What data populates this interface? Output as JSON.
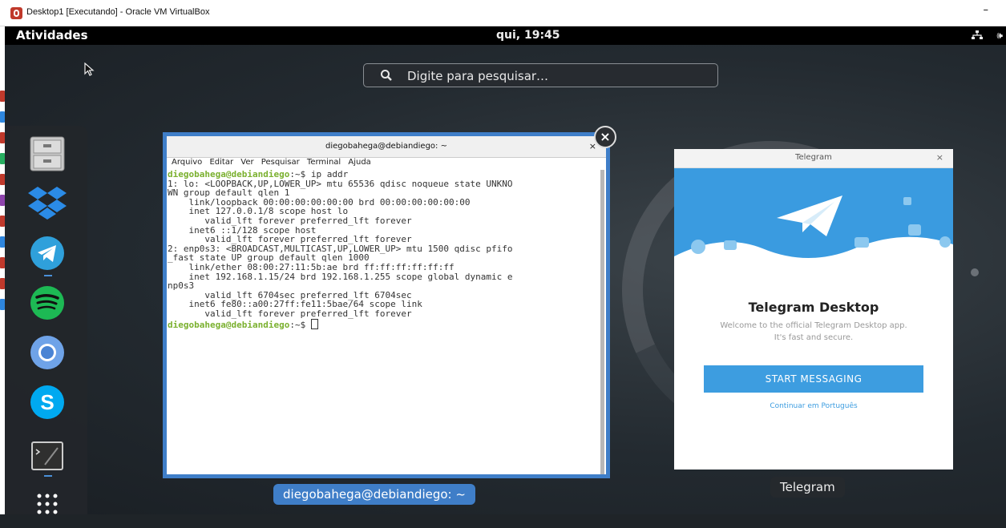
{
  "host": {
    "window_title": "Desktop1 [Executando] - Oracle VM VirtualBox",
    "minimize_symbol": "–",
    "strip_colors": [
      "#c0392b",
      "#2e86de",
      "#c0392b",
      "#27ae60",
      "#c0392b",
      "#8e44ad",
      "#c0392b",
      "#2e86de",
      "#c0392b",
      "#c0392b",
      "#2e86de"
    ]
  },
  "top_bar": {
    "activities": "Atividades",
    "clock": "qui, 19:45",
    "volume_icon": "🕪"
  },
  "search": {
    "placeholder": "Digite para pesquisar…"
  },
  "dash": {
    "apps": [
      {
        "name": "files",
        "icon": "file-cabinet-icon"
      },
      {
        "name": "dropbox",
        "icon": "dropbox-icon"
      },
      {
        "name": "telegram",
        "icon": "telegram-icon",
        "running": true
      },
      {
        "name": "spotify",
        "icon": "spotify-icon"
      },
      {
        "name": "chromium",
        "icon": "chromium-icon"
      },
      {
        "name": "skype",
        "icon": "skype-icon"
      },
      {
        "name": "terminal",
        "icon": "terminal-icon",
        "running": true
      },
      {
        "name": "show-applications",
        "icon": "app-grid-icon"
      }
    ]
  },
  "terminal": {
    "title": "diegobahega@debiandiego: ~",
    "close": "×",
    "menu": [
      "Arquivo",
      "Editar",
      "Ver",
      "Pesquisar",
      "Terminal",
      "Ajuda"
    ],
    "prompt": "diegobahega@debiandiego",
    "prompt_suffix": ":~$ ",
    "command": "ip addr",
    "output": [
      "1: lo: <LOOPBACK,UP,LOWER_UP> mtu 65536 qdisc noqueue state UNKNO",
      "WN group default qlen 1",
      "    link/loopback 00:00:00:00:00:00 brd 00:00:00:00:00:00",
      "    inet 127.0.0.1/8 scope host lo",
      "       valid_lft forever preferred_lft forever",
      "    inet6 ::1/128 scope host",
      "       valid_lft forever preferred_lft forever",
      "2: enp0s3: <BROADCAST,MULTICAST,UP,LOWER_UP> mtu 1500 qdisc pfifo",
      "_fast state UP group default qlen 1000",
      "    link/ether 08:00:27:11:5b:ae brd ff:ff:ff:ff:ff:ff",
      "    inet 192.168.1.15/24 brd 192.168.1.255 scope global dynamic e",
      "np0s3",
      "       valid_lft 6704sec preferred_lft 6704sec",
      "    inet6 fe80::a00:27ff:fe11:5bae/64 scope link",
      "       valid_lft forever preferred_lft forever"
    ],
    "close_overview": "×",
    "caption": "diegobahega@debiandiego: ~"
  },
  "telegram": {
    "title": "Telegram",
    "close": "×",
    "heading": "Telegram Desktop",
    "desc_line1": "Welcome to the official Telegram Desktop app.",
    "desc_line2": "It's fast and secure.",
    "button": "START MESSAGING",
    "link": "Continuar em Português",
    "caption": "Telegram"
  }
}
